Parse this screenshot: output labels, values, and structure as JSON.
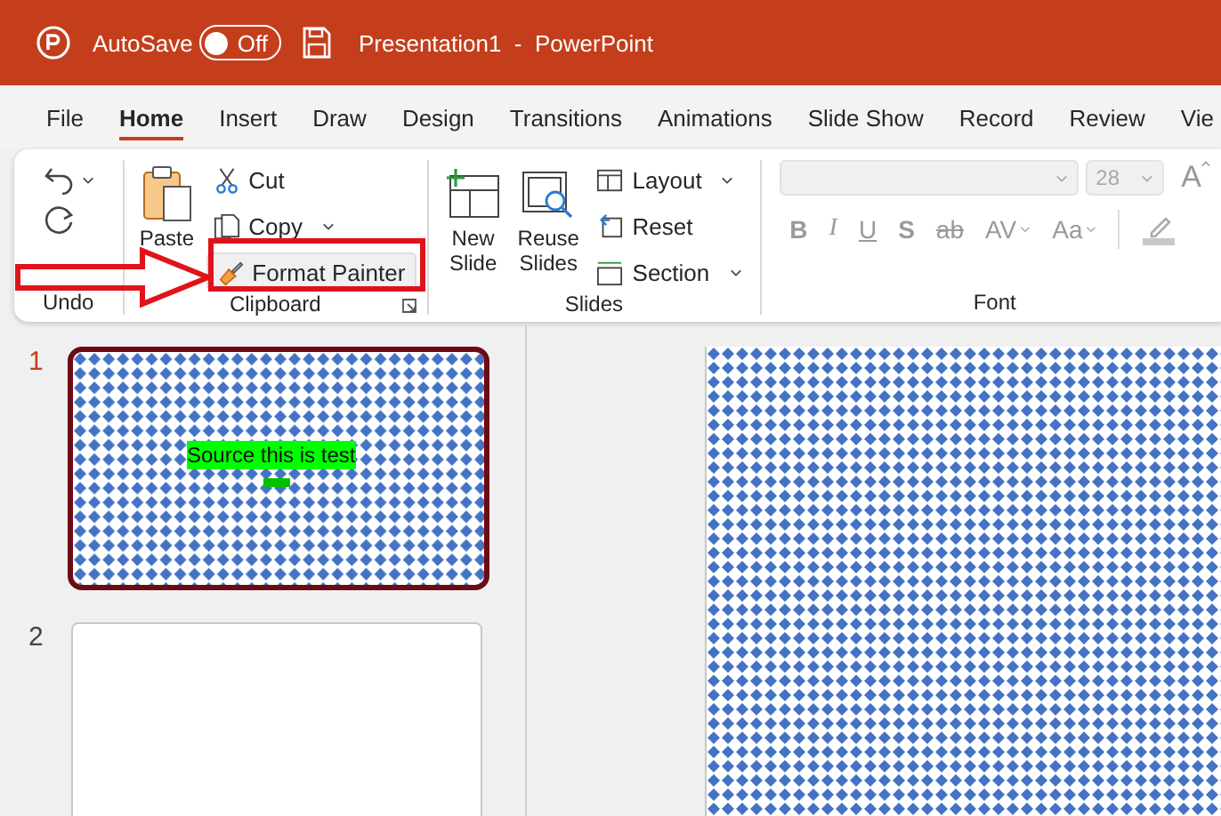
{
  "title_bar": {
    "autosave_label": "AutoSave",
    "autosave_toggle": {
      "label": "Off",
      "on": false
    },
    "title": "Presentation1  -  PowerPoint"
  },
  "tabs": [
    {
      "label": "File",
      "selected": false
    },
    {
      "label": "Home",
      "selected": true
    },
    {
      "label": "Insert",
      "selected": false
    },
    {
      "label": "Draw",
      "selected": false
    },
    {
      "label": "Design",
      "selected": false
    },
    {
      "label": "Transitions",
      "selected": false
    },
    {
      "label": "Animations",
      "selected": false
    },
    {
      "label": "Slide Show",
      "selected": false
    },
    {
      "label": "Record",
      "selected": false
    },
    {
      "label": "Review",
      "selected": false
    },
    {
      "label": "Vie",
      "selected": false
    }
  ],
  "ribbon": {
    "undo": {
      "label": "Undo"
    },
    "clipboard": {
      "paste": "Paste",
      "cut": "Cut",
      "copy": "Copy",
      "format_painter": "Format Painter",
      "label": "Clipboard"
    },
    "slides": {
      "new_slide": "New Slide",
      "reuse_slides": "Reuse Slides",
      "layout": "Layout",
      "reset": "Reset",
      "section": "Section",
      "label": "Slides"
    },
    "font": {
      "size": "28",
      "grow": "A",
      "format_buttons": [
        {
          "label": "B",
          "kind": "bold"
        },
        {
          "label": "I",
          "kind": "italic"
        },
        {
          "label": "U",
          "kind": "underline"
        },
        {
          "label": "S",
          "kind": "shadow"
        },
        {
          "label": "ab",
          "kind": "strike"
        },
        {
          "label": "AV",
          "kind": "spacing"
        },
        {
          "label": "Aa",
          "kind": "case"
        }
      ],
      "label": "Font"
    }
  },
  "annotation": {
    "format_painter_highlighted": true
  },
  "thumbnails": [
    {
      "number": "1",
      "selected": true,
      "kind": "pattern",
      "text": "Source this is test"
    },
    {
      "number": "2",
      "selected": false,
      "kind": "blank"
    }
  ],
  "main_slide": {
    "kind": "pattern"
  }
}
